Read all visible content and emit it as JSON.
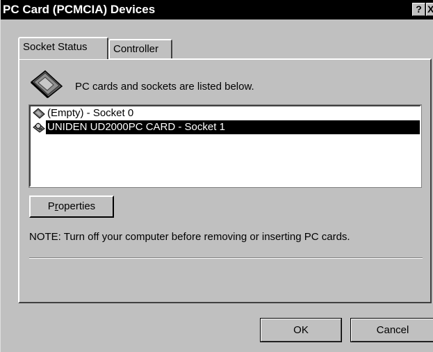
{
  "window": {
    "title": "PC Card (PCMCIA) Devices",
    "help_label": "?",
    "close_label": "X"
  },
  "tabs": [
    {
      "label": "Socket Status",
      "active": true
    },
    {
      "label": "Controller",
      "active": false
    }
  ],
  "panel": {
    "info_text": "PC cards and sockets are listed below.",
    "list_items": [
      {
        "label": "(Empty) - Socket 0",
        "icon": "pc-card-icon",
        "selected": false
      },
      {
        "label": "UNIDEN UD2000PC CARD - Socket 1",
        "icon": "modem-card-icon",
        "selected": true
      }
    ],
    "properties_label_prefix": "P",
    "properties_label_underlined": "r",
    "properties_label_suffix": "operties",
    "note": "NOTE: Turn off your computer before removing or inserting  PC cards."
  },
  "buttons": {
    "ok_label": "OK",
    "cancel_label": "Cancel"
  },
  "colors": {
    "face": "#c0c0c0",
    "selection": "#000000",
    "titlebar": "#000000"
  }
}
